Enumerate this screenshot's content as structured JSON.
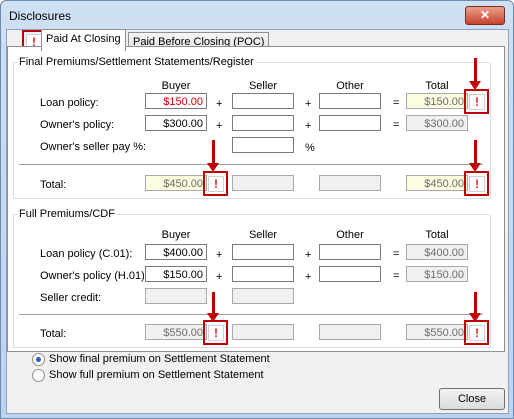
{
  "window": {
    "title": "Disclosures",
    "close_glyph": "✕"
  },
  "tabs": [
    {
      "label": "Paid At Closing"
    },
    {
      "label": "Paid Before Closing (POC)"
    }
  ],
  "alert_glyph": "!",
  "final_section": {
    "title": "Final Premiums/Settlement Statements/Register",
    "columns": {
      "buyer": "Buyer",
      "seller": "Seller",
      "other": "Other",
      "total": "Total"
    },
    "rows": {
      "loan": {
        "label": "Loan policy:",
        "buyer": "$150.00",
        "seller": "",
        "other": "",
        "total": "$150.00"
      },
      "owner": {
        "label": "Owner's policy:",
        "buyer": "$300.00",
        "seller": "",
        "other": "",
        "total": "$300.00"
      },
      "owner_seller_pct": {
        "label": "Owner's seller pay %:",
        "value": "",
        "unit": "%"
      },
      "total": {
        "label": "Total:",
        "buyer": "$450.00",
        "seller": "",
        "other": "",
        "total": "$450.00"
      }
    }
  },
  "full_section": {
    "title": "Full Premiums/CDF",
    "columns": {
      "buyer": "Buyer",
      "seller": "Seller",
      "other": "Other",
      "total": "Total"
    },
    "rows": {
      "loan": {
        "label": "Loan policy (C.01):",
        "buyer": "$400.00",
        "seller": "",
        "other": "",
        "total": "$400.00"
      },
      "owner": {
        "label": "Owner's policy (H.01):",
        "buyer": "$150.00",
        "seller": "",
        "other": "",
        "total": "$150.00"
      },
      "seller_credit": {
        "label": "Seller credit:",
        "buyer": "",
        "seller": ""
      },
      "total": {
        "label": "Total:",
        "buyer": "$550.00",
        "seller": "",
        "other": "",
        "total": "$550.00"
      }
    }
  },
  "operators": {
    "plus": "+",
    "equals": "="
  },
  "options": [
    {
      "label": "Show final premium on Settlement Statement",
      "selected": true
    },
    {
      "label": "Show full premium on Settlement Statement",
      "selected": false
    }
  ],
  "footer": {
    "close_label": "Close"
  },
  "colors": {
    "annotation": "#c00000",
    "alert": "#e0202e",
    "negative_value": "#d00000"
  }
}
